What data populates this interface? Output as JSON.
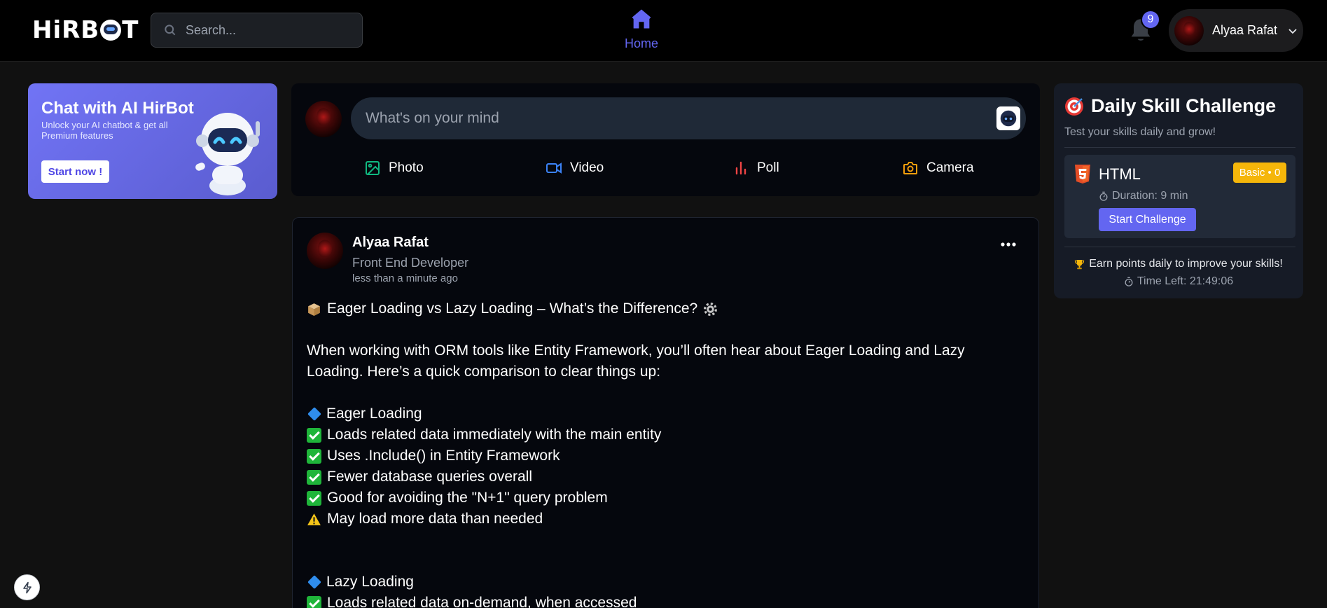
{
  "header": {
    "logo_text": "HiRBOT",
    "search": {
      "placeholder": "Search..."
    },
    "home_label": "Home",
    "notification_count": "9",
    "user": {
      "name": "Alyaa Rafat"
    }
  },
  "promo": {
    "title": "Chat with AI HirBot",
    "description": "Unlock your AI chatbot & get all Premium features",
    "button_label": "Start now !"
  },
  "composer": {
    "placeholder": "What's on your mind",
    "actions": [
      {
        "label": "Photo",
        "icon": "image-icon",
        "color": "#10b981"
      },
      {
        "label": "Video",
        "icon": "video-icon",
        "color": "#3b82f6"
      },
      {
        "label": "Poll",
        "icon": "poll-icon",
        "color": "#ef4444"
      },
      {
        "label": "Camera",
        "icon": "camera-icon",
        "color": "#f59e0b"
      }
    ]
  },
  "post": {
    "author": "Alyaa Rafat",
    "role": "Front End Developer",
    "time": "less than a minute ago",
    "lines": {
      "heading": "Eager Loading vs Lazy Loading – What’s the Difference?",
      "intro_1": "When working with ORM tools like Entity Framework, you’ll often hear about Eager Loading and Lazy",
      "intro_2": "Loading. Here’s a quick comparison to clear things up:",
      "eager_title": "Eager Loading",
      "eager_1": "Loads related data immediately with the main entity",
      "eager_2": "Uses .Include() in Entity Framework",
      "eager_3": "Fewer database queries overall",
      "eager_4": "Good for avoiding the \"N+1\" query problem",
      "eager_warn": "May load more data than needed",
      "lazy_title": "Lazy Loading",
      "lazy_1": "Loads related data on-demand, when accessed"
    }
  },
  "challenge": {
    "title": "Daily Skill Challenge",
    "subtitle": "Test your skills daily and grow!",
    "language": "HTML",
    "badge": "Basic • 0",
    "duration": "Duration: 9 min",
    "start_label": "Start Challenge",
    "earn_text": "Earn points daily to improve your skills!",
    "time_left": "Time Left: 21:49:06"
  },
  "colors": {
    "accent": "#6366f1",
    "badge": "#f5b60a",
    "check": "#1fb53a",
    "diamond": "#2f8ded"
  }
}
